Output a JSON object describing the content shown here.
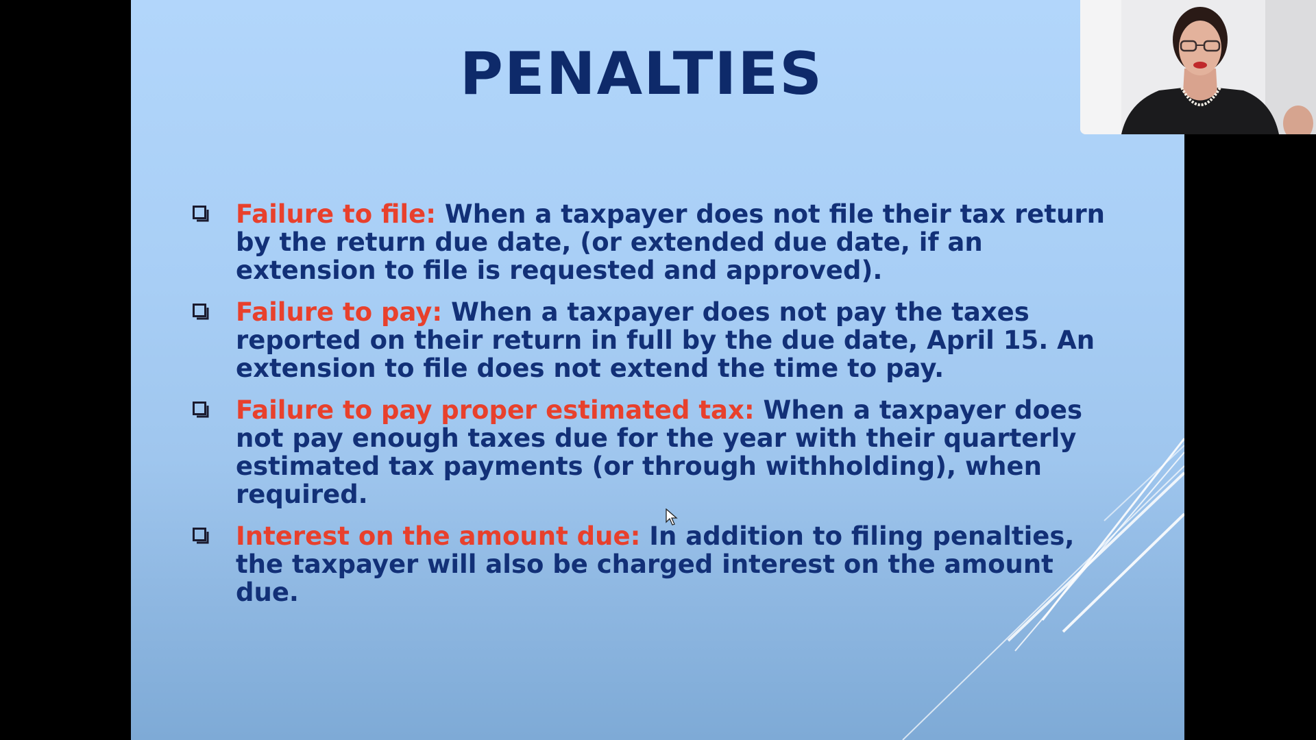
{
  "slide": {
    "title": "PENALTIES",
    "bullets": [
      {
        "lead": "Failure to file:",
        "text": " When a taxpayer does not file their tax return by the return due date, (or extended due date, if an extension to file is requested and approved)."
      },
      {
        "lead": "Failure to pay:",
        "text": " When a taxpayer does not pay the taxes reported on their return in full by the due date, April 15. An extension to file does not extend the time to pay."
      },
      {
        "lead": "Failure to pay proper estimated tax:",
        "text": " When a taxpayer does not pay enough taxes due for the year with their quarterly estimated tax payments (or through withholding), when required."
      },
      {
        "lead": "Interest on the amount due:",
        "text": " In addition to filing penalties, the taxpayer will also be charged interest on the amount due."
      }
    ],
    "bullet_icon": "checkbox-square-icon"
  },
  "colors": {
    "title": "#0e2a6a",
    "body_text": "#123077",
    "lead_text": "#e8402c",
    "slide_background": "#a9cff6",
    "letterbox": "#000000"
  },
  "webcam": {
    "icon": "presenter-video-feed"
  },
  "cursor": {
    "icon": "mouse-pointer-icon"
  }
}
